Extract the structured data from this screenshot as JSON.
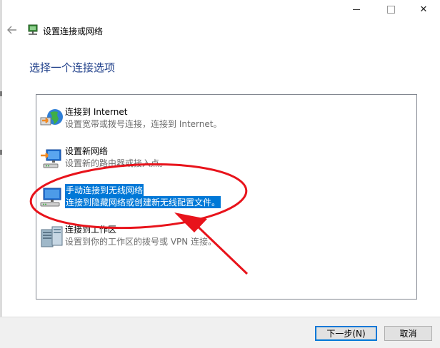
{
  "window": {
    "title": "设置连接或网络",
    "back_icon": "back-arrow-icon",
    "controls": {
      "minimize": "minimize-icon",
      "maximize": "maximize-icon",
      "close_glyph": "✕"
    }
  },
  "heading": "选择一个连接选项",
  "options": [
    {
      "title": "连接到 Internet",
      "description": "设置宽带或拨号连接，连接到 Internet。",
      "icon": "globe-network-icon",
      "selected": false
    },
    {
      "title": "设置新网络",
      "description": "设置新的路由器或接入点。",
      "icon": "router-setup-icon",
      "selected": false
    },
    {
      "title": "手动连接到无线网络",
      "description": "连接到隐藏网络或创建新无线配置文件。",
      "icon": "wireless-network-icon",
      "selected": true
    },
    {
      "title": "连接到工作区",
      "description": "设置到你的工作区的拨号或 VPN 连接。",
      "icon": "workplace-server-icon",
      "selected": false
    }
  ],
  "buttons": {
    "next": "下一步(N)",
    "cancel": "取消"
  },
  "colors": {
    "heading": "#1f3f8a",
    "selection": "#0078d7",
    "annotation": "#e8131b"
  }
}
